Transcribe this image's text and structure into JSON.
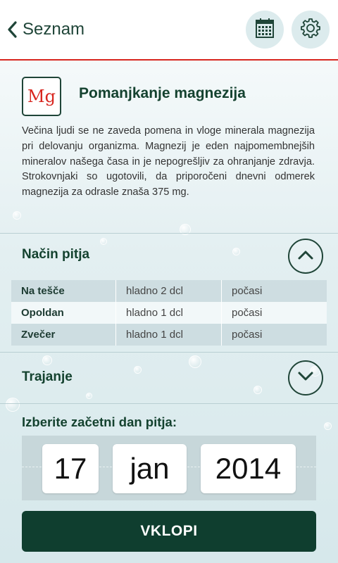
{
  "nav": {
    "back_label": "Seznam"
  },
  "icons": {
    "back": "chevron-left-icon",
    "calendar": "calendar-icon",
    "settings": "gear-icon",
    "expand_up": "chevron-up-icon",
    "expand_down": "chevron-down-icon"
  },
  "colors": {
    "accent_red": "#d8261f",
    "primary_green": "#0f3e2f",
    "text_green": "#14422f"
  },
  "mineral": {
    "symbol": "Mg",
    "title": "Pomanjkanje magnezija",
    "description": "Večina ljudi se ne zaveda pomena in vloge minerala magnezija pri delovanju organizma. Magnezij je eden najpomembnejših mineralov našega časa in je nepogrešljiv za ohranjanje zdravja. Strokovnjaki so ugotovili, da priporočeni dnevni odmerek magnezija za odrasle znaša 375 mg."
  },
  "drinking": {
    "title": "Način pitja",
    "rows": [
      {
        "time": "Na tešče",
        "amount": "hladno 2 dcl",
        "pace": "počasi"
      },
      {
        "time": "Opoldan",
        "amount": "hladno 1 dcl",
        "pace": "počasi"
      },
      {
        "time": "Zvečer",
        "amount": "hladno 1 dcl",
        "pace": "počasi"
      }
    ]
  },
  "duration": {
    "title": "Trajanje"
  },
  "start_date": {
    "label": "Izberite začetni dan pitja:",
    "day": "17",
    "month": "jan",
    "year": "2014"
  },
  "action": {
    "label": "VKLOPI"
  }
}
